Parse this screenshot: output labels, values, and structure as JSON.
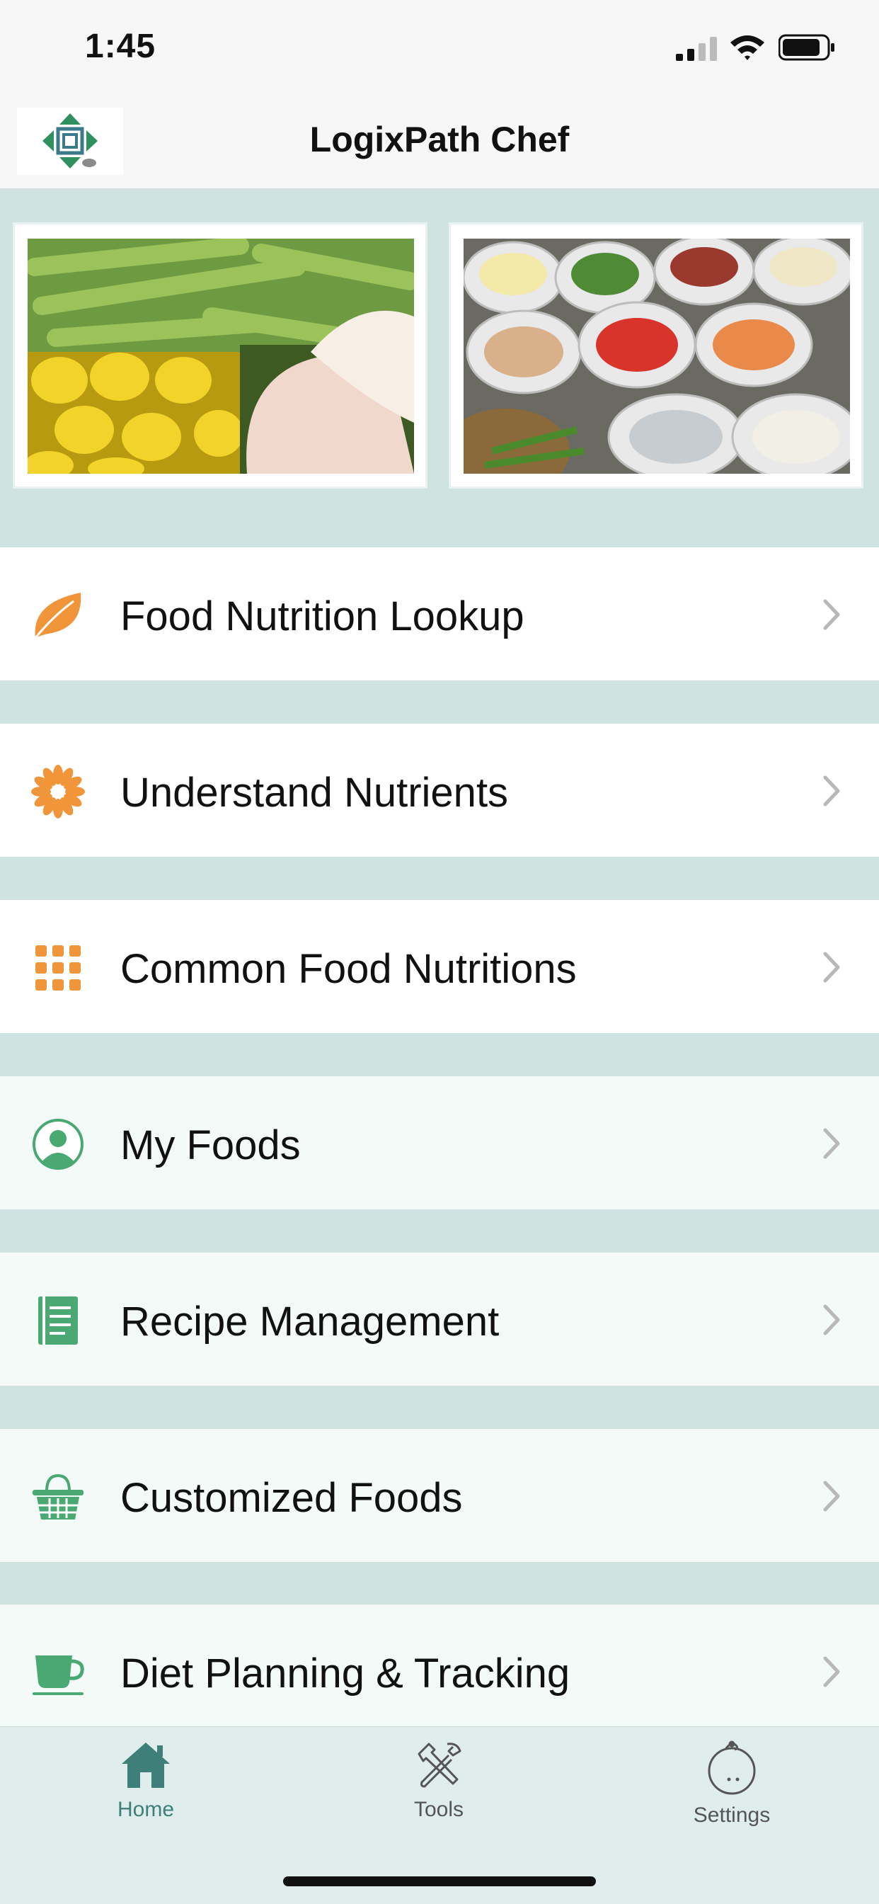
{
  "status_bar": {
    "time": "1:45"
  },
  "header": {
    "title": "LogixPath Chef"
  },
  "menu": [
    {
      "label": "Food Nutrition Lookup",
      "icon": "leaf-icon",
      "color": "#f0953a"
    },
    {
      "label": "Understand Nutrients",
      "icon": "flower-icon",
      "color": "#f0953a"
    },
    {
      "label": "Common Food Nutritions",
      "icon": "grid-icon",
      "color": "#f0953a"
    },
    {
      "label": "My Foods",
      "icon": "person-icon",
      "color": "#4aa872"
    },
    {
      "label": "Recipe Management",
      "icon": "document-icon",
      "color": "#4aa872"
    },
    {
      "label": "Customized Foods",
      "icon": "basket-icon",
      "color": "#4aa872"
    },
    {
      "label": "Diet Planning & Tracking",
      "icon": "cup-icon",
      "color": "#4aa872"
    }
  ],
  "tabs": [
    {
      "label": "Home",
      "icon": "home-icon",
      "selected": true
    },
    {
      "label": "Tools",
      "icon": "tools-icon",
      "selected": false
    },
    {
      "label": "Settings",
      "icon": "settings-face-icon",
      "selected": false
    }
  ],
  "colors": {
    "accent_orange": "#f0953a",
    "accent_green": "#4aa872",
    "tab_selected": "#3f7f79",
    "background": "#cfe3e1"
  }
}
